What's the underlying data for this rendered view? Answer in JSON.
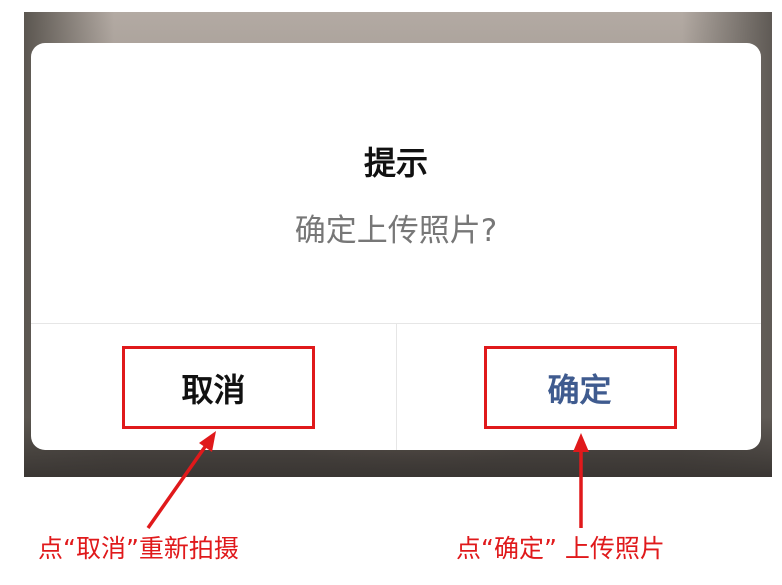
{
  "dialog": {
    "title": "提示",
    "message": "确定上传照片?",
    "cancel_label": "取消",
    "confirm_label": "确定"
  },
  "annotations": {
    "cancel_note": "点“取消”重新拍摄",
    "confirm_note": "点“确定” 上传照片",
    "highlight_color": "#e0191b"
  },
  "colors": {
    "confirm_text": "#3f5b8f",
    "message_text": "#777777"
  }
}
